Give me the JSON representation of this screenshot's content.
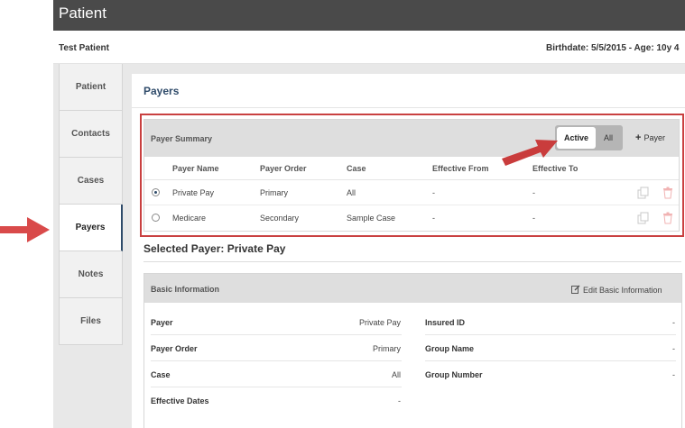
{
  "app": {
    "title": "Patient"
  },
  "patient": {
    "name": "Test Patient",
    "birthdate_line": "Birthdate: 5/5/2015 - Age: 10y 4"
  },
  "sidebar": {
    "items": [
      {
        "label": "Patient"
      },
      {
        "label": "Contacts"
      },
      {
        "label": "Cases"
      },
      {
        "label": "Payers",
        "active": true
      },
      {
        "label": "Notes"
      },
      {
        "label": "Files"
      }
    ]
  },
  "page": {
    "title": "Payers"
  },
  "summary": {
    "title": "Payer Summary",
    "toggle": {
      "active_label": "Active",
      "all_label": "All",
      "selected": "Active"
    },
    "add_label": "Payer",
    "columns": [
      "Payer Name",
      "Payer Order",
      "Case",
      "Effective From",
      "Effective To"
    ],
    "rows": [
      {
        "selected": true,
        "payer_name": "Private Pay",
        "payer_order": "Primary",
        "case": "All",
        "effective_from": "-",
        "effective_to": "-"
      },
      {
        "selected": false,
        "payer_name": "Medicare",
        "payer_order": "Secondary",
        "case": "Sample Case",
        "effective_from": "-",
        "effective_to": "-"
      }
    ]
  },
  "selected_payer": {
    "title": "Selected Payer: Private Pay",
    "basic_info": {
      "title": "Basic Information",
      "edit_label": "Edit Basic Information",
      "left_fields": [
        {
          "label": "Payer",
          "value": "Private Pay"
        },
        {
          "label": "Payer Order",
          "value": "Primary"
        },
        {
          "label": "Case",
          "value": "All"
        },
        {
          "label": "Effective Dates",
          "value": "-"
        }
      ],
      "right_fields": [
        {
          "label": "Insured ID",
          "value": "-"
        },
        {
          "label": "Group Name",
          "value": "-"
        },
        {
          "label": "Group Number",
          "value": "-"
        }
      ]
    }
  },
  "colors": {
    "topbar": "#4a4a4a",
    "accent_navy": "#2f4b6a",
    "annotation_red": "#c94040",
    "panel_header": "#dedede"
  },
  "icons": {
    "add": "plus-icon",
    "copy": "copy-icon",
    "delete": "trash-icon",
    "edit": "edit-icon",
    "annotation": "arrow-icon"
  }
}
